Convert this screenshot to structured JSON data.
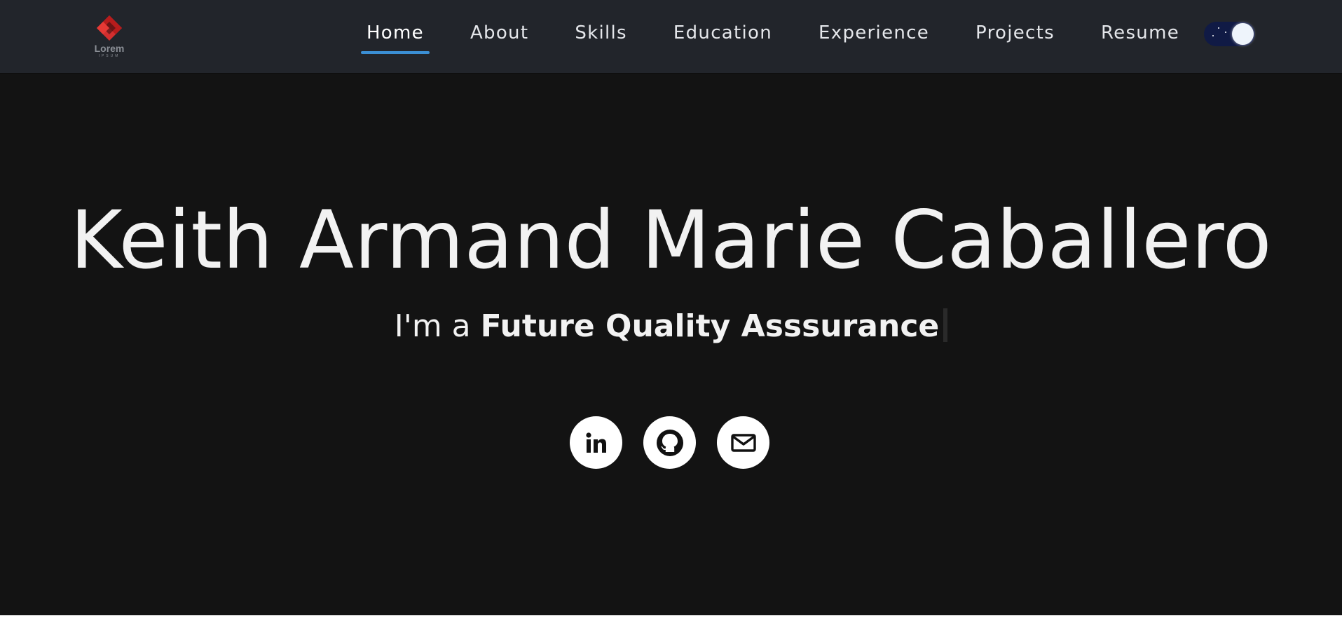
{
  "brand": {
    "logo_text": "Lorem",
    "logo_subtext": "IPSUM",
    "logo_color": "#d32f2f"
  },
  "nav": {
    "items": [
      {
        "label": "Home",
        "active": true
      },
      {
        "label": "About",
        "active": false
      },
      {
        "label": "Skills",
        "active": false
      },
      {
        "label": "Education",
        "active": false
      },
      {
        "label": "Experience",
        "active": false
      },
      {
        "label": "Projects",
        "active": false
      },
      {
        "label": "Resume",
        "active": false
      }
    ],
    "active_underline_color": "#3b8fd4",
    "theme_toggle": {
      "mode": "dark",
      "icon": "moon-toggle-icon"
    }
  },
  "hero": {
    "name": "Keith Armand Marie Caballero",
    "tagline_prefix": "I'm a",
    "tagline_role": "Future Quality Asssurance",
    "socials": [
      {
        "name": "linkedin",
        "icon": "linkedin-icon"
      },
      {
        "name": "github",
        "icon": "github-icon"
      },
      {
        "name": "email",
        "icon": "mail-icon"
      }
    ]
  },
  "colors": {
    "navbar_bg": "#22252b",
    "hero_bg": "#131313",
    "text": "#f2f2f2",
    "toggle_bg": "#101a45"
  }
}
